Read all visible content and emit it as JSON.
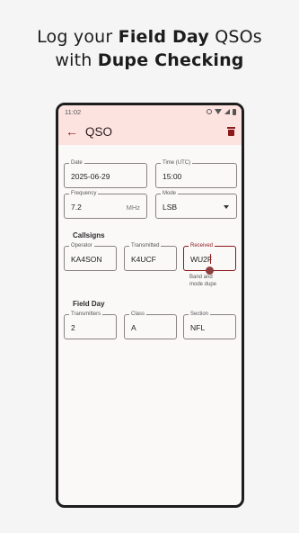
{
  "headline": {
    "line1_pre": "Log your ",
    "line1_bold": "Field Day",
    "line1_post": " QSOs",
    "line2_pre": "with ",
    "line2_bold": "Dupe Checking"
  },
  "status": {
    "time": "11:02"
  },
  "appbar": {
    "title": "QSO",
    "back_icon": "arrow-back-icon",
    "delete_icon": "trash-icon"
  },
  "fields": {
    "date": {
      "label": "Date",
      "value": "2025-06-29"
    },
    "time": {
      "label": "Time (UTC)",
      "value": "15:00"
    },
    "frequency": {
      "label": "Frequency",
      "value": "7.2",
      "suffix": "MHz"
    },
    "mode": {
      "label": "Mode",
      "value": "LSB"
    }
  },
  "callsigns": {
    "heading": "Callsigns",
    "operator": {
      "label": "Operator",
      "value": "KA4SON"
    },
    "transmitted": {
      "label": "Transmitted",
      "value": "K4UCF"
    },
    "received": {
      "label": "Received",
      "value": "WU2F",
      "helper_line1": "Band and",
      "helper_line2": "mode dupe"
    }
  },
  "field_day": {
    "heading": "Field Day",
    "transmitters": {
      "label": "Transmitters",
      "value": "2"
    },
    "class": {
      "label": "Class",
      "value": "A"
    },
    "section": {
      "label": "Section",
      "value": "NFL"
    }
  },
  "colors": {
    "accent": "#8b1a1a",
    "appbar_bg": "#fde3e0",
    "page_bg": "#f5f5f5"
  }
}
